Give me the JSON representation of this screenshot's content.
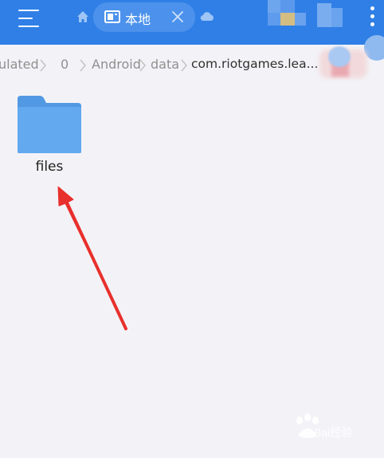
{
  "colors": {
    "topbar": "#2f7fe6",
    "tab_background": "#4c92ec",
    "folder": "#63a9ef",
    "folder_back": "#5299e3",
    "arrow": "#e8302c",
    "background": "#f3f3f7"
  },
  "toolbar": {
    "menu_icon": "menu-icon",
    "home_icon": "home-icon",
    "cloud_icon": "cloud-icon",
    "more_icon": "more-vertical-icon"
  },
  "tab": {
    "label": "本地",
    "icon": "device-icon",
    "close_icon": "close-icon"
  },
  "breadcrumb": {
    "items": [
      {
        "label": "ulated"
      },
      {
        "label": "0"
      },
      {
        "label": "Android"
      },
      {
        "label": "data"
      },
      {
        "label": "com.riotgames.lea..."
      }
    ]
  },
  "files": [
    {
      "name": "files",
      "type": "folder",
      "icon": "folder-icon"
    }
  ],
  "watermark": {
    "text": "Bai经验"
  }
}
